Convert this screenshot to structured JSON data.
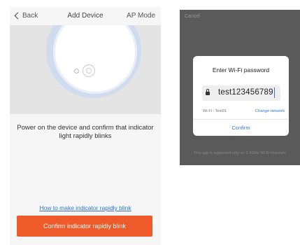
{
  "left_screen": {
    "header": {
      "back_label": "Back",
      "title": "Add Device",
      "mode_label": "AP Mode"
    },
    "instruction": "Power on the device and confirm that indicator light rapidly blinks",
    "help_link": "How to make indicator rapidly blink",
    "confirm_button": "Confirm indicator rapidly blink"
  },
  "right_screen": {
    "cancel_label": "Cancel",
    "dialog": {
      "title": "Enter Wi-Fi password",
      "password_value": "test123456789",
      "wifi_info": "Wi-Fi : Test01",
      "change_network": "Change network",
      "confirm_label": "Confirm"
    },
    "footer_note": "This app is supported only on 2.4GHz Wi-Fi channels"
  },
  "colors": {
    "accent_orange": "#ef5a2a",
    "link_blue": "#2f74d9",
    "overlay_gray": "#5a5a5a"
  }
}
